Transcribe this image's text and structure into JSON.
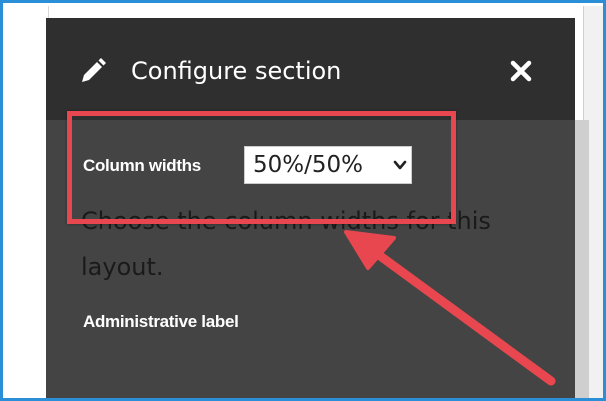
{
  "dialog": {
    "title": "Configure section",
    "close_symbol": "✕"
  },
  "column_widths": {
    "label": "Column widths",
    "selected": "50%/50%",
    "description": "Choose the column widths for this layout."
  },
  "administrative_label": {
    "label": "Administrative label"
  },
  "icons": {
    "edit": "pencil-icon",
    "close": "close-icon",
    "dropdown": "chevron-down-icon"
  },
  "colors": {
    "frame_border": "#2a8fd6",
    "panel_background": "#444444",
    "header_background": "#2f2f2f",
    "annotation": "#e8474f"
  }
}
